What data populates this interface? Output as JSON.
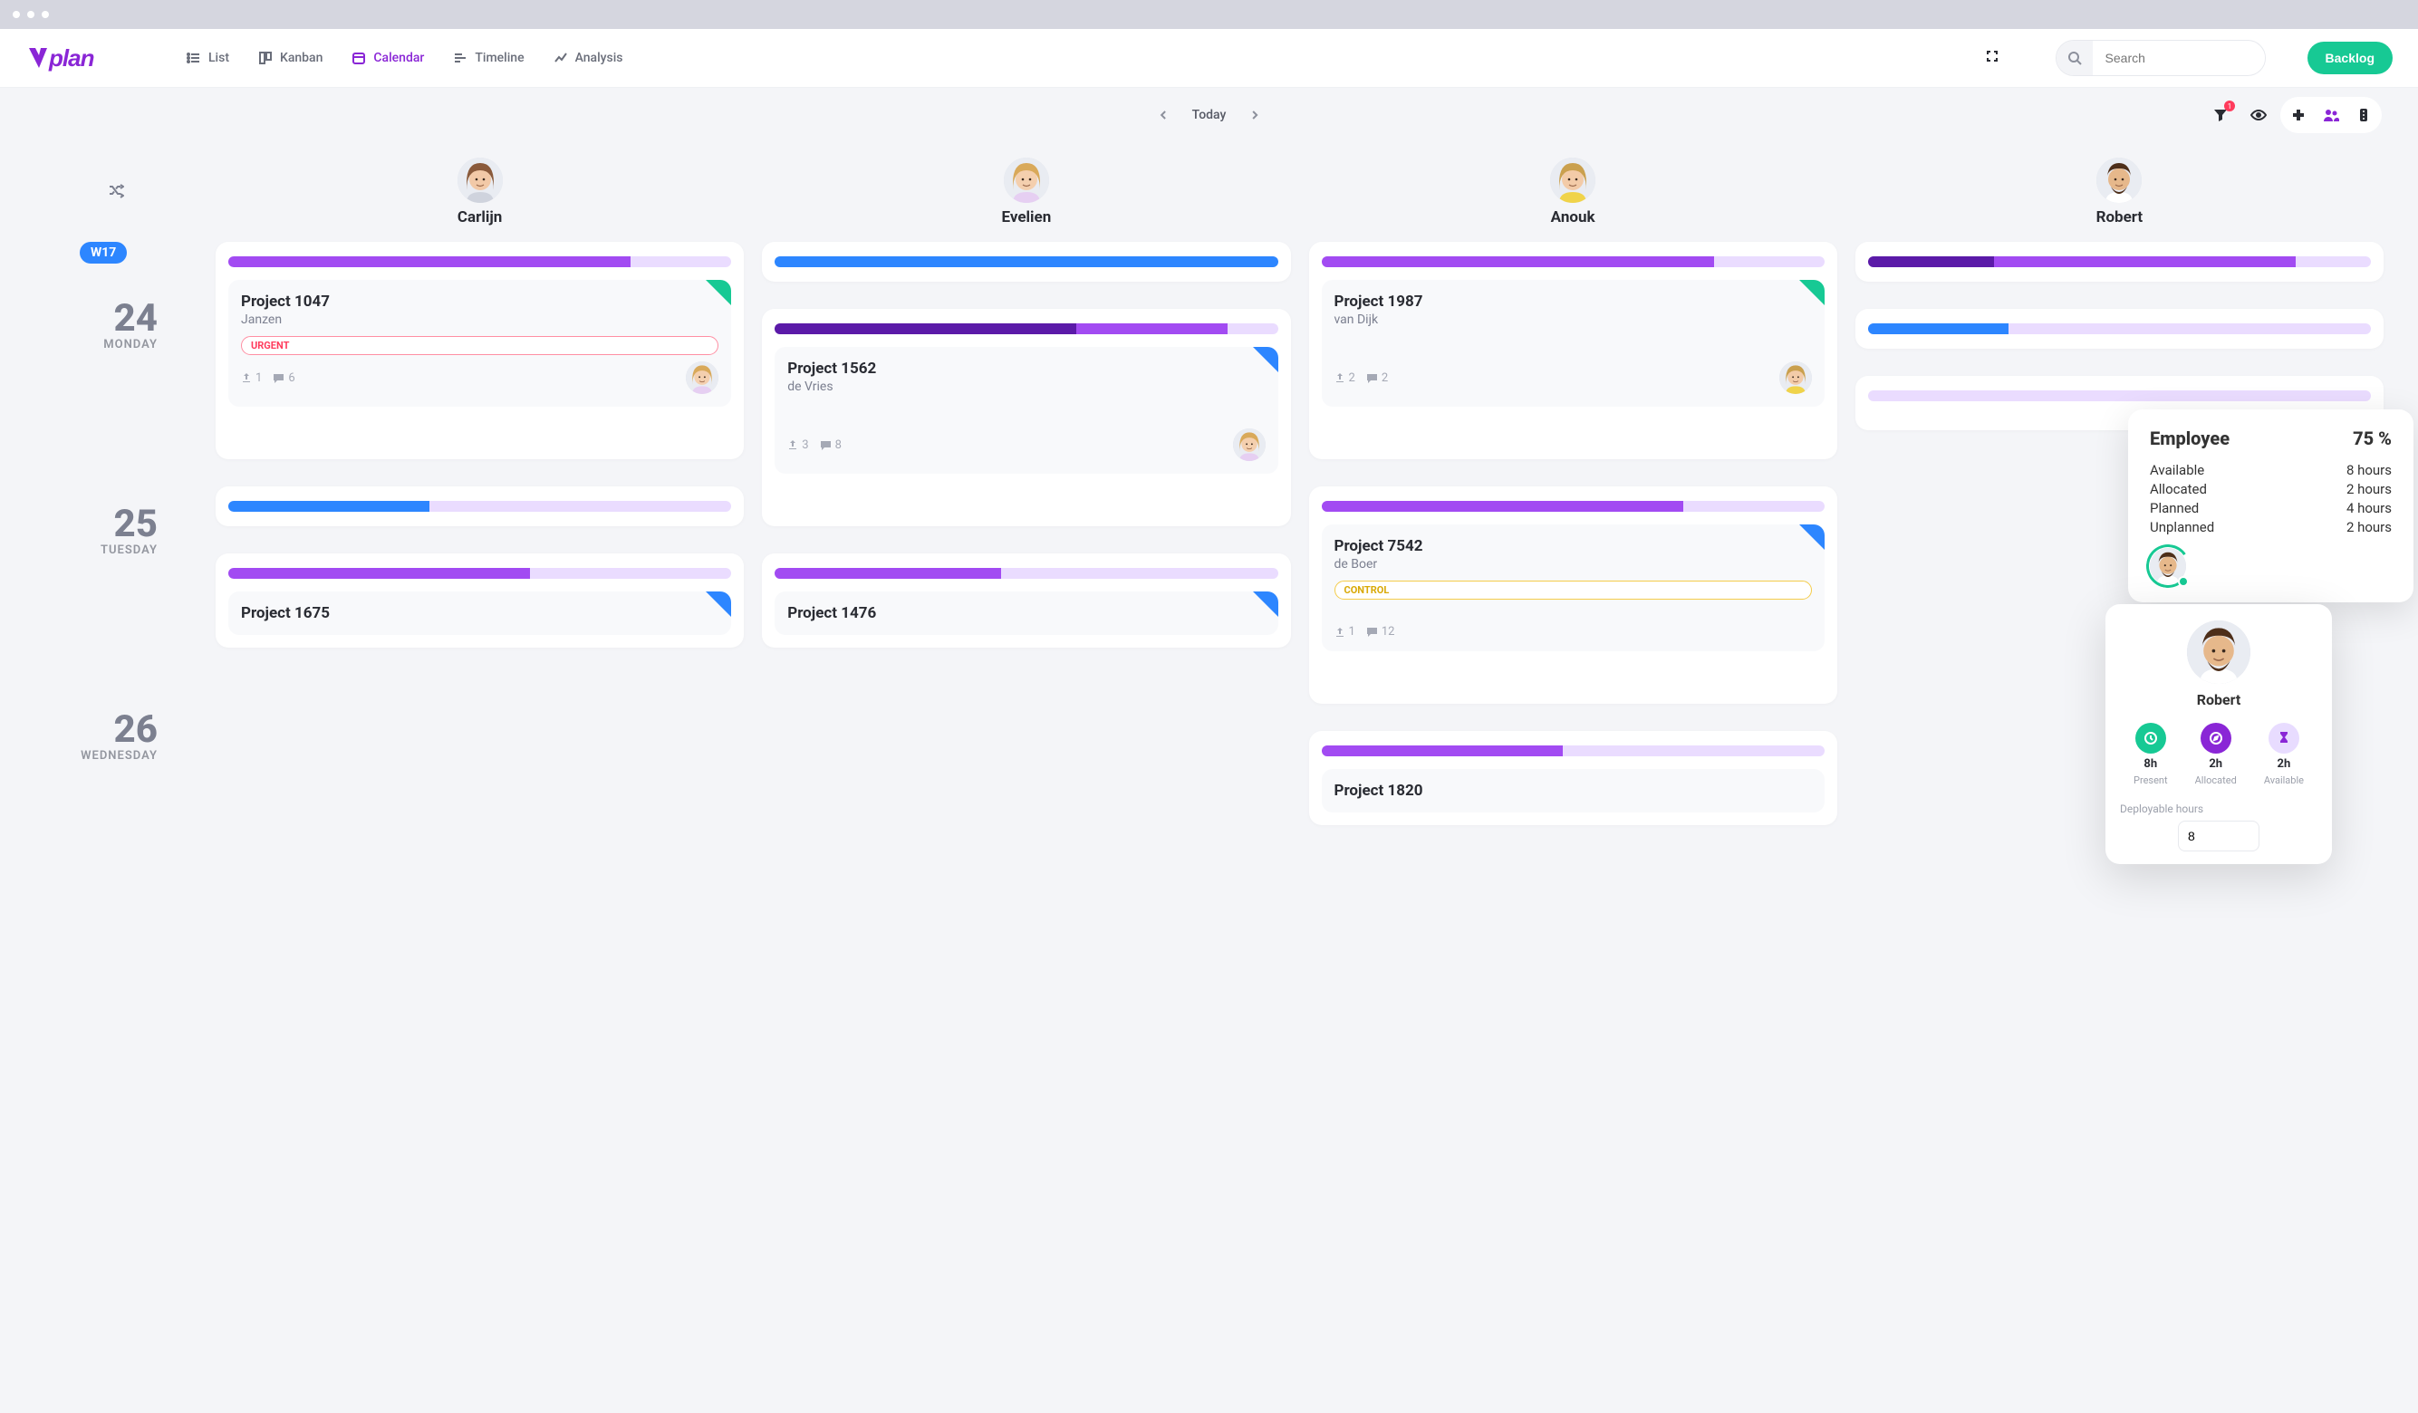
{
  "nav": {
    "views": {
      "list": "List",
      "kanban": "Kanban",
      "calendar": "Calendar",
      "timeline": "Timeline",
      "analysis": "Analysis"
    },
    "active": "calendar"
  },
  "search": {
    "placeholder": "Search"
  },
  "backlog_label": "Backlog",
  "toolbar": {
    "today_label": "Today",
    "filter_badge": "1"
  },
  "week_badge": "W17",
  "people": [
    {
      "id": "carlijn",
      "name": "Carlijn",
      "hair": "#8a5a3b",
      "skin": "#f2c9a7",
      "shirt": "#cfd3dd"
    },
    {
      "id": "evelien",
      "name": "Evelien",
      "hair": "#d9a95a",
      "skin": "#f4cfae",
      "shirt": "#e6cff2"
    },
    {
      "id": "anouk",
      "name": "Anouk",
      "hair": "#caa04e",
      "skin": "#f3cba8",
      "shirt": "#f0d34a"
    },
    {
      "id": "robert",
      "name": "Robert",
      "hair": "#4d2e19",
      "skin": "#e6b88b",
      "shirt": "#ffffff",
      "beard": "#4d2e19"
    }
  ],
  "days": [
    {
      "num": "24",
      "name": "MONDAY"
    },
    {
      "num": "25",
      "name": "TUESDAY"
    },
    {
      "num": "26",
      "name": "WEDNESDAY"
    }
  ],
  "lanes": {
    "carlijn": {
      "rows": [
        {
          "cap": [
            {
              "c": "cap-purple",
              "w": 80
            }
          ],
          "task": {
            "title": "Project 1047",
            "sub": "Janzen",
            "tag": {
              "type": "urgent",
              "text": "URGENT"
            },
            "corner": "green",
            "up": "1",
            "comments": "6",
            "assignee": "evelien"
          }
        },
        {
          "cap": [
            {
              "c": "cap-blue",
              "w": 40
            }
          ]
        },
        {
          "cap": [
            {
              "c": "cap-purple",
              "w": 60
            }
          ],
          "task": {
            "title": "Project 1675",
            "corner": "blue",
            "small": true
          }
        }
      ]
    },
    "evelien": {
      "rows": [
        {
          "cap": [
            {
              "c": "cap-blue",
              "w": 100
            }
          ]
        },
        {
          "cap": [
            {
              "c": "cap-dpurple",
              "w": 60
            },
            {
              "c": "cap-purple",
              "w": 30
            }
          ],
          "task": {
            "title": "Project 1562",
            "sub": "de Vries",
            "corner": "blue",
            "up": "3",
            "comments": "8",
            "assignee": "evelien"
          }
        },
        {
          "cap": [
            {
              "c": "cap-purple",
              "w": 45
            }
          ],
          "task": {
            "title": "Project 1476",
            "corner": "blue",
            "small": true
          }
        }
      ]
    },
    "anouk": {
      "rows": [
        {
          "cap": [
            {
              "c": "cap-purple",
              "w": 78
            }
          ],
          "task": {
            "title": "Project 1987",
            "sub": "van Dijk",
            "corner": "green",
            "up": "2",
            "comments": "2",
            "assignee": "anouk"
          }
        },
        {
          "cap": [
            {
              "c": "cap-purple",
              "w": 72
            }
          ],
          "task": {
            "title": "Project 7542",
            "sub": "de Boer",
            "tag": {
              "type": "control",
              "text": "CONTROL"
            },
            "corner": "blue",
            "up": "1",
            "comments": "12"
          }
        },
        {
          "cap": [
            {
              "c": "cap-purple",
              "w": 48
            }
          ],
          "task": {
            "title": "Project 1820",
            "small": true
          }
        }
      ]
    },
    "robert": {
      "rows": [
        {
          "cap": [
            {
              "c": "cap-dpurple",
              "w": 25
            },
            {
              "c": "cap-purple",
              "w": 60
            }
          ]
        },
        {
          "cap": [
            {
              "c": "cap-blue",
              "w": 28
            }
          ]
        },
        {
          "cap": []
        }
      ]
    }
  },
  "employee_popover": {
    "title": "Employee",
    "pct": "75 %",
    "rows": [
      {
        "label": "Available",
        "value": "8 hours"
      },
      {
        "label": "Allocated",
        "value": "2 hours"
      },
      {
        "label": "Planned",
        "value": "4 hours"
      },
      {
        "label": "Unplanned",
        "value": "2 hours"
      }
    ],
    "avatar_person": "robert"
  },
  "robert_popover": {
    "name": "Robert",
    "stats": [
      {
        "icon": "clock",
        "cls": "stat-green",
        "val": "8h",
        "label": "Present"
      },
      {
        "icon": "compass",
        "cls": "stat-purple",
        "val": "2h",
        "label": "Allocated"
      },
      {
        "icon": "hourglass",
        "cls": "stat-lilac",
        "val": "2h",
        "label": "Available"
      }
    ],
    "deploy_label": "Deployable hours",
    "deploy_value": "8"
  }
}
